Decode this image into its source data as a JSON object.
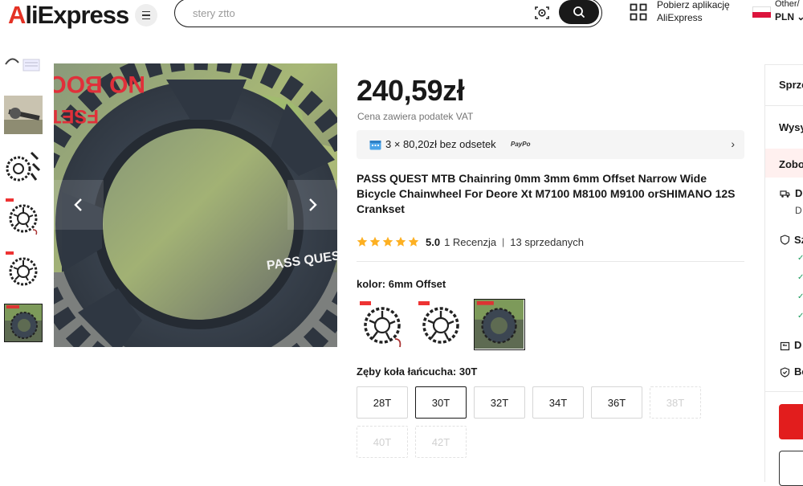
{
  "header": {
    "logo": "AliExpress",
    "search_placeholder": "stery ztto",
    "app_line1": "Pobierz aplikację",
    "app_line2": "AliExpress",
    "region_line1": "Other/",
    "region_currency": "PLN ⌄"
  },
  "gallery": {
    "overlay_line1": "NO BOOST",
    "overlay_line2": "FSET",
    "brand_text": "PASS QUEST",
    "selected_thumb": 6
  },
  "product": {
    "price": "240,59zł",
    "vat": "Cena zawiera podatek VAT",
    "installments": "3 × 80,20zł bez odsetek",
    "installments_provider": "PayPo",
    "title": "PASS QUEST MTB Chainring 0mm 3mm 6mm Offset Narrow Wide Bicycle Chainwheel For Deore Xt M7100 M8100 M9100 orSHIMANO 12S Crankset",
    "rating": {
      "stars": 5,
      "score": "5.0",
      "reviews": "1 Recenzja",
      "separator": "|",
      "sold": "13 sprzedanych"
    },
    "color_label": "kolor: 6mm Offset",
    "color_selected": 3,
    "teeth_label": "Zęby koła łańcucha: 30T",
    "sizes": [
      {
        "label": "28T",
        "state": "normal"
      },
      {
        "label": "30T",
        "state": "selected"
      },
      {
        "label": "32T",
        "state": "normal"
      },
      {
        "label": "34T",
        "state": "normal"
      },
      {
        "label": "36T",
        "state": "normal"
      },
      {
        "label": "38T",
        "state": "disabled"
      },
      {
        "label": "40T",
        "state": "disabled"
      },
      {
        "label": "42T",
        "state": "disabled"
      }
    ]
  },
  "side_panel": {
    "seller": "Sprze",
    "shipping": "Wysy",
    "see": "Zobo",
    "delivery": "D",
    "delivery_sub": "D",
    "safety": "Sz",
    "returns": "D",
    "security": "Be"
  },
  "colors": {
    "accent": "#e21d1d",
    "star": "#fdb022",
    "dark": "#191919"
  }
}
